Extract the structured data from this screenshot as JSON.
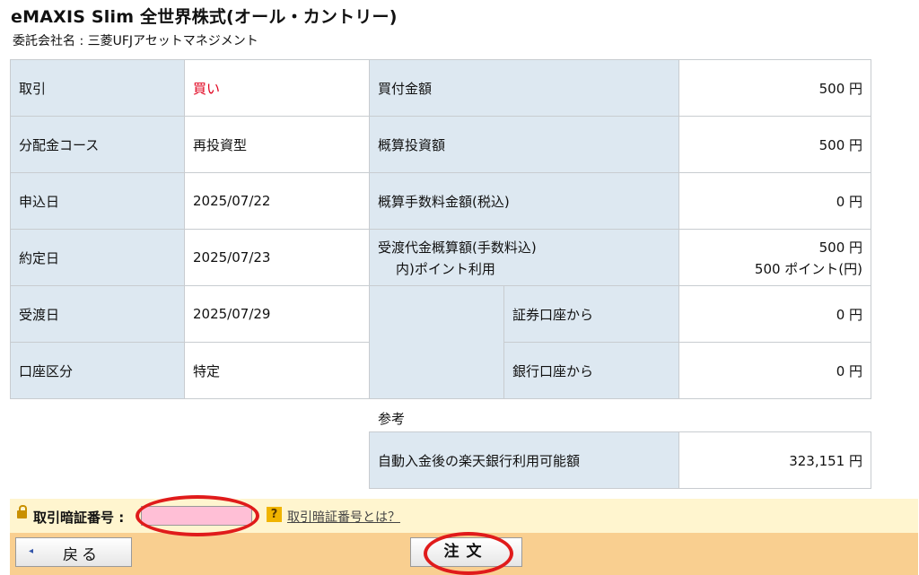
{
  "fund": {
    "title": "eMAXIS Slim 全世界株式(オール・カントリー)",
    "company": "委託会社名 : 三菱UFJアセットマネジメント"
  },
  "details": {
    "trade_label": "取引",
    "trade_value": "買い",
    "course_label": "分配金コース",
    "course_value": "再投資型",
    "apply_date_label": "申込日",
    "apply_date_value": "2025/07/22",
    "contract_date_label": "約定日",
    "contract_date_value": "2025/07/23",
    "delivery_date_label": "受渡日",
    "delivery_date_value": "2025/07/29",
    "account_type_label": "口座区分",
    "account_type_value": "特定",
    "purchase_amount_label": "買付金額",
    "purchase_amount_value": "500 円",
    "est_investment_label": "概算投資額",
    "est_investment_value": "500 円",
    "est_fee_label": "概算手数料金額(税込)",
    "est_fee_value": "0 円",
    "settlement_label": "受渡代金概算額(手数料込)",
    "settlement_value": "500 円",
    "points_label": "内)ポイント利用",
    "points_value": "500 ポイント(円)",
    "from_securities_label": "証券口座から",
    "from_securities_value": "0 円",
    "from_bank_label": "銀行口座から",
    "from_bank_value": "0 円"
  },
  "reference": {
    "title": "参考",
    "bank_available_label": "自動入金後の楽天銀行利用可能額",
    "bank_available_value": "323,151 円"
  },
  "pin": {
    "label": "取引暗証番号 :",
    "value": "",
    "help_icon_text": "?",
    "help_link": "取引暗証番号とは？"
  },
  "actions": {
    "back_icon": "◂",
    "back_label": "戻る",
    "order_label": "注文"
  },
  "colors": {
    "label_bg": "#dde8f1",
    "buy_text": "#e0001c",
    "pin_bar_bg": "#fff5cf",
    "pin_input_bg": "#ffbfd6",
    "button_bar_bg": "#f9cf90",
    "highlight_circle": "#e01b1b"
  }
}
